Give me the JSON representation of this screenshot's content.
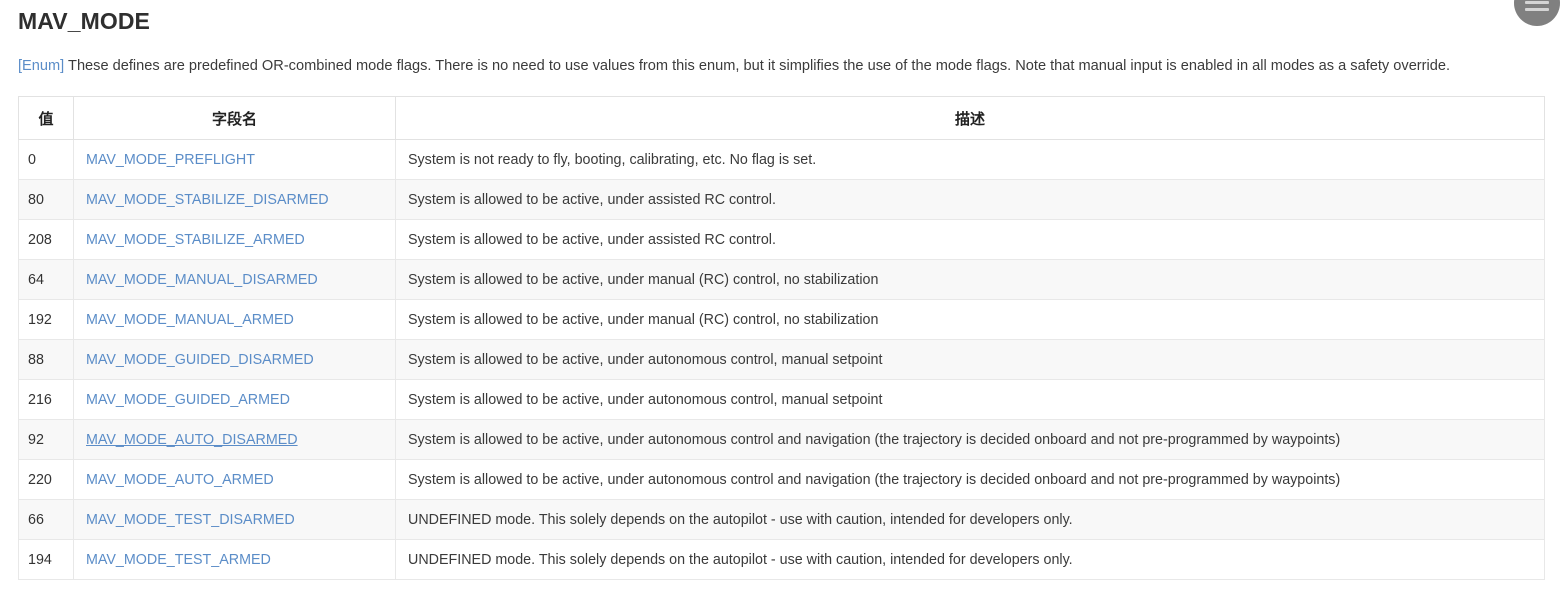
{
  "page": {
    "title": "MAV_MODE",
    "intro_link": "[Enum]",
    "intro_text": " These defines are predefined OR-combined mode flags. There is no need to use values from this enum, but it simplifies the use of the mode flags. Note that manual input is enabled in all modes as a safety override."
  },
  "fab": {
    "icon": "hamburger-menu-icon"
  },
  "table": {
    "headers": {
      "value": "值",
      "name": "字段名",
      "description": "描述"
    },
    "rows": [
      {
        "value": "0",
        "name": "MAV_MODE_PREFLIGHT",
        "description": "System is not ready to fly, booting, calibrating, etc. No flag is set.",
        "hovered": false
      },
      {
        "value": "80",
        "name": "MAV_MODE_STABILIZE_DISARMED",
        "description": "System is allowed to be active, under assisted RC control.",
        "hovered": false
      },
      {
        "value": "208",
        "name": "MAV_MODE_STABILIZE_ARMED",
        "description": "System is allowed to be active, under assisted RC control.",
        "hovered": false
      },
      {
        "value": "64",
        "name": "MAV_MODE_MANUAL_DISARMED",
        "description": "System is allowed to be active, under manual (RC) control, no stabilization",
        "hovered": false
      },
      {
        "value": "192",
        "name": "MAV_MODE_MANUAL_ARMED",
        "description": "System is allowed to be active, under manual (RC) control, no stabilization",
        "hovered": false
      },
      {
        "value": "88",
        "name": "MAV_MODE_GUIDED_DISARMED",
        "description": "System is allowed to be active, under autonomous control, manual setpoint",
        "hovered": false
      },
      {
        "value": "216",
        "name": "MAV_MODE_GUIDED_ARMED",
        "description": "System is allowed to be active, under autonomous control, manual setpoint",
        "hovered": false
      },
      {
        "value": "92",
        "name": "MAV_MODE_AUTO_DISARMED",
        "description": "System is allowed to be active, under autonomous control and navigation (the trajectory is decided onboard and not pre-programmed by waypoints)",
        "hovered": true
      },
      {
        "value": "220",
        "name": "MAV_MODE_AUTO_ARMED",
        "description": "System is allowed to be active, under autonomous control and navigation (the trajectory is decided onboard and not pre-programmed by waypoints)",
        "hovered": false
      },
      {
        "value": "66",
        "name": "MAV_MODE_TEST_DISARMED",
        "description": "UNDEFINED mode. This solely depends on the autopilot - use with caution, intended for developers only.",
        "hovered": false
      },
      {
        "value": "194",
        "name": "MAV_MODE_TEST_ARMED",
        "description": "UNDEFINED mode. This solely depends on the autopilot - use with caution, intended for developers only.",
        "hovered": false
      }
    ]
  },
  "colors": {
    "link": "#5b8dc8",
    "text": "#333333",
    "row_alt": "#f8f8f8",
    "border": "#e8e8e8",
    "fab": "#808080"
  }
}
